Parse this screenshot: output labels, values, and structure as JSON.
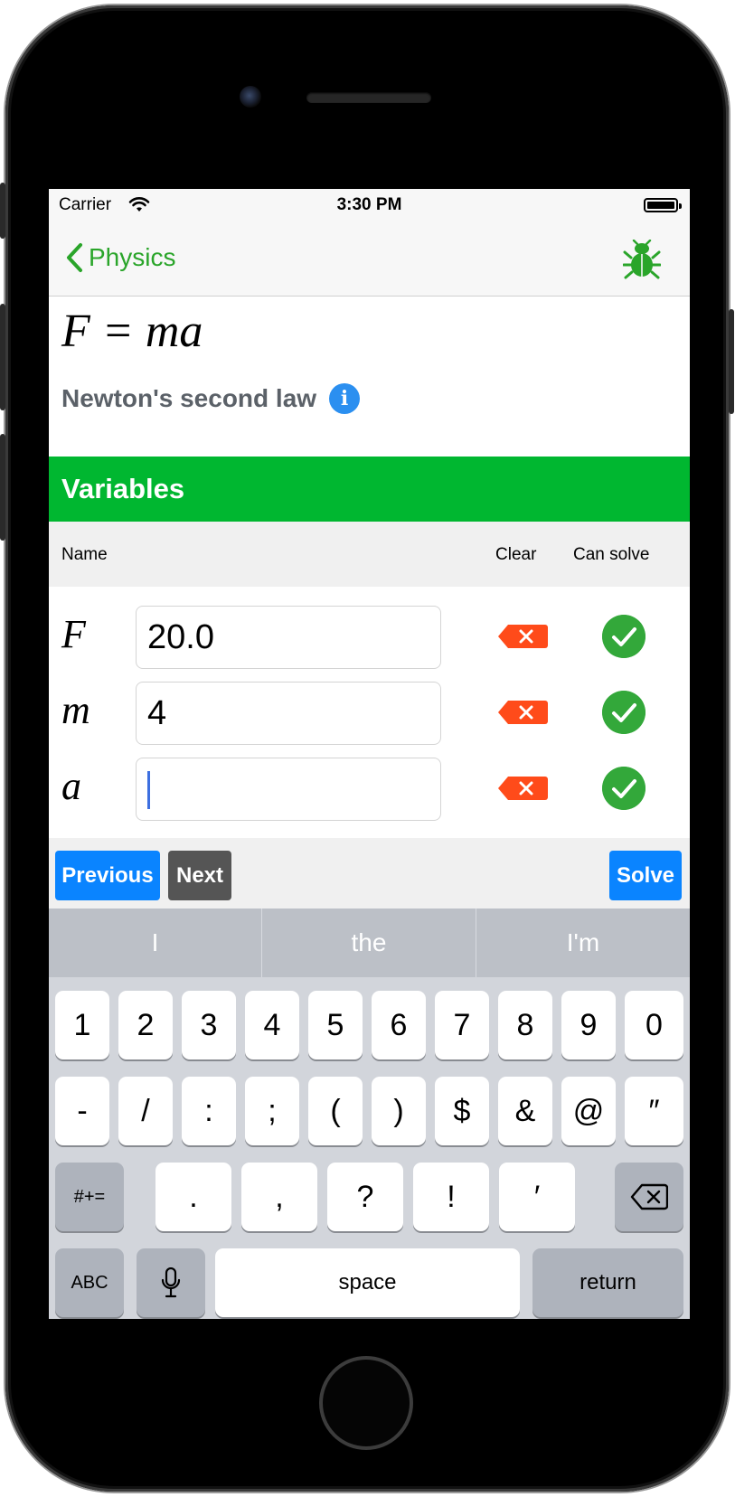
{
  "status_bar": {
    "carrier": "Carrier",
    "time": "3:30 PM"
  },
  "nav": {
    "back_label": "Physics",
    "bug_icon": "bug-icon",
    "accent": "#2aa52a"
  },
  "equation": {
    "formula": "F = ma",
    "title": "Newton's second law"
  },
  "variables": {
    "header": "Variables",
    "columns": {
      "name": "Name",
      "clear": "Clear",
      "can_solve": "Can solve"
    },
    "rows": [
      {
        "name": "F",
        "value": "20.0",
        "can_solve": true
      },
      {
        "name": "m",
        "value": "4",
        "can_solve": true
      },
      {
        "name": "a",
        "value": "",
        "can_solve": true,
        "focused": true
      }
    ]
  },
  "toolbar": {
    "previous": "Previous",
    "next": "Next",
    "solve": "Solve"
  },
  "keyboard": {
    "suggestions": [
      "I",
      "the",
      "I'm"
    ],
    "row1": [
      "1",
      "2",
      "3",
      "4",
      "5",
      "6",
      "7",
      "8",
      "9",
      "0"
    ],
    "row2": [
      "-",
      "/",
      ":",
      ";",
      "(",
      ")",
      "$",
      "&",
      "@",
      "″"
    ],
    "row3": {
      "toggle": "#+=",
      "keys": [
        ".",
        ",",
        "?",
        "!",
        "′"
      ]
    },
    "row4": {
      "abc": "ABC",
      "space": "space",
      "return": "return"
    }
  },
  "colors": {
    "section_green": "#00b730",
    "info_blue": "#2b8ff0",
    "button_blue": "#0a84ff",
    "next_gray": "#555555",
    "clear_red": "#ff4b1a",
    "check_green": "#33a83a"
  }
}
